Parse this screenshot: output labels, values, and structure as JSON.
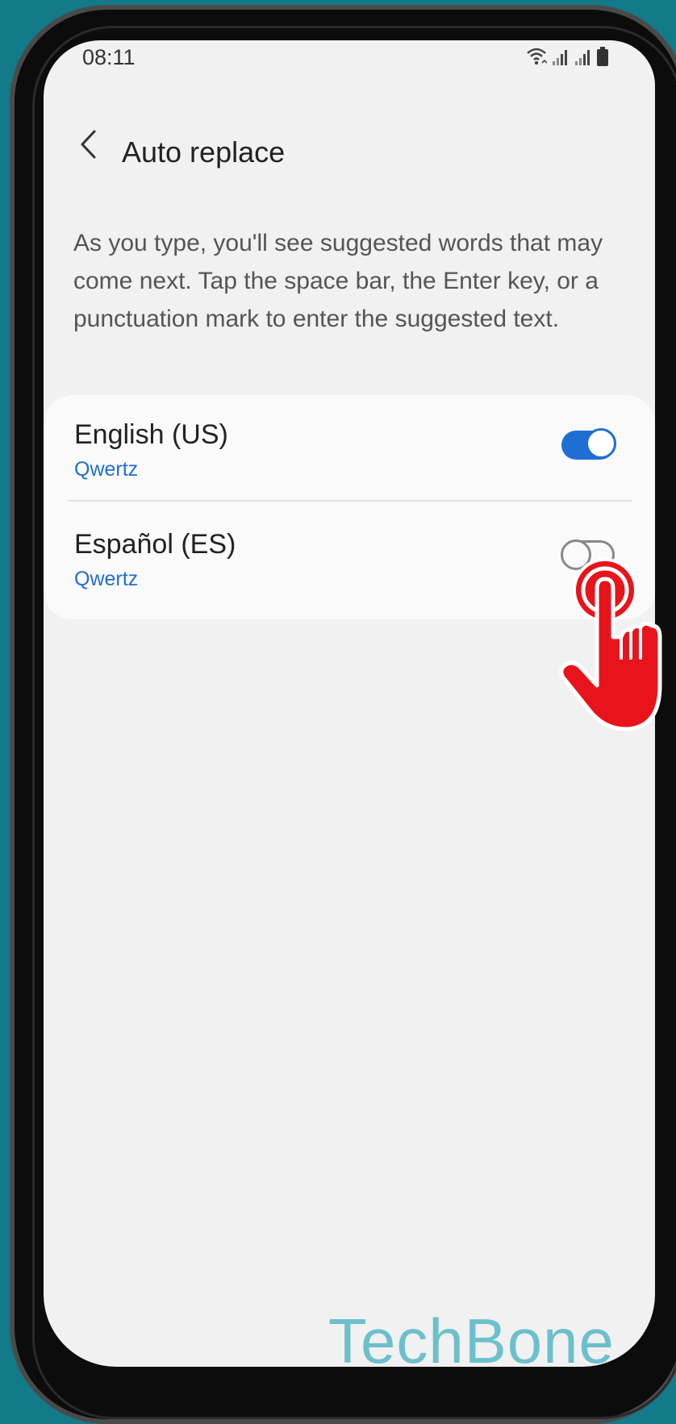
{
  "status_bar": {
    "time": "08:11"
  },
  "header": {
    "title": "Auto replace"
  },
  "description": "As you type, you'll see suggested words that may come next. Tap the space bar, the Enter key, or a punctuation mark to enter the suggested text.",
  "languages": [
    {
      "name": "English (US)",
      "layout": "Qwertz",
      "enabled": true
    },
    {
      "name": "Español (ES)",
      "layout": "Qwertz",
      "enabled": false
    }
  ],
  "watermark": "TechBone",
  "colors": {
    "accent": "#1f6ed4",
    "background": "#127a88",
    "watermark": "#6cc0cc",
    "pointer": "#e8141b"
  }
}
